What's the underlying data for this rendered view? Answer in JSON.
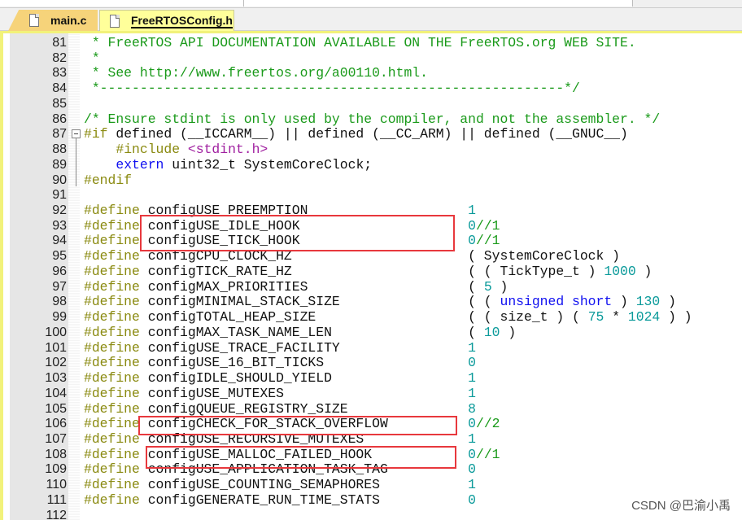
{
  "tabs": [
    {
      "label": "main.c",
      "active": false
    },
    {
      "label": "FreeRTOSConfig.h",
      "active": true
    }
  ],
  "colors": {
    "comment": "#1a9a1a",
    "preprocessor": "#8a8a10",
    "number": "#0a9a9a",
    "keyword": "#1010f0",
    "string": "#a020a0",
    "highlight_box": "#e8383d"
  },
  "lines": [
    {
      "n": "81",
      "seg": [
        [
          "c",
          " * FreeRTOS API DOCUMENTATION AVAILABLE ON THE FreeRTOS.org WEB SITE."
        ]
      ]
    },
    {
      "n": "82",
      "seg": [
        [
          "c",
          " *"
        ]
      ]
    },
    {
      "n": "83",
      "seg": [
        [
          "c",
          " * See http://www.freertos.org/a00110.html."
        ]
      ]
    },
    {
      "n": "84",
      "seg": [
        [
          "c",
          " *----------------------------------------------------------*/"
        ]
      ]
    },
    {
      "n": "85",
      "seg": []
    },
    {
      "n": "86",
      "seg": [
        [
          "c",
          "/* Ensure stdint is only used by the compiler, and not the assembler. */"
        ]
      ]
    },
    {
      "n": "87",
      "seg": [
        [
          "p",
          "#if"
        ],
        [
          "t",
          " defined (__ICCARM__) || defined (__CC_ARM) || defined (__GNUC__)"
        ]
      ]
    },
    {
      "n": "88",
      "seg": [
        [
          "t",
          "    "
        ],
        [
          "p",
          "#include "
        ],
        [
          "s",
          "<stdint.h>"
        ]
      ]
    },
    {
      "n": "89",
      "seg": [
        [
          "t",
          "    "
        ],
        [
          "k",
          "extern"
        ],
        [
          "t",
          " uint32_t SystemCoreClock;"
        ]
      ]
    },
    {
      "n": "90",
      "seg": [
        [
          "p",
          "#endif"
        ]
      ]
    },
    {
      "n": "91",
      "seg": []
    },
    {
      "n": "92",
      "seg": [
        [
          "p",
          "#define"
        ],
        [
          "t",
          " configUSE_PREEMPTION                    "
        ],
        [
          "n",
          "1"
        ]
      ]
    },
    {
      "n": "93",
      "seg": [
        [
          "p",
          "#define"
        ],
        [
          "t",
          " configUSE_IDLE_HOOK                     "
        ],
        [
          "n",
          "0"
        ],
        [
          "c",
          "//1"
        ]
      ]
    },
    {
      "n": "94",
      "seg": [
        [
          "p",
          "#define"
        ],
        [
          "t",
          " configUSE_TICK_HOOK                     "
        ],
        [
          "n",
          "0"
        ],
        [
          "c",
          "//1"
        ]
      ]
    },
    {
      "n": "95",
      "seg": [
        [
          "p",
          "#define"
        ],
        [
          "t",
          " configCPU_CLOCK_HZ                      ( SystemCoreClock )"
        ]
      ]
    },
    {
      "n": "96",
      "seg": [
        [
          "p",
          "#define"
        ],
        [
          "t",
          " configTICK_RATE_HZ                      ( ( TickType_t ) "
        ],
        [
          "n",
          "1000"
        ],
        [
          "t",
          " )"
        ]
      ]
    },
    {
      "n": "97",
      "seg": [
        [
          "p",
          "#define"
        ],
        [
          "t",
          " configMAX_PRIORITIES                    ( "
        ],
        [
          "n",
          "5"
        ],
        [
          "t",
          " )"
        ]
      ]
    },
    {
      "n": "98",
      "seg": [
        [
          "p",
          "#define"
        ],
        [
          "t",
          " configMINIMAL_STACK_SIZE                ( ( "
        ],
        [
          "k",
          "unsigned short"
        ],
        [
          "t",
          " ) "
        ],
        [
          "n",
          "130"
        ],
        [
          "t",
          " )"
        ]
      ]
    },
    {
      "n": "99",
      "seg": [
        [
          "p",
          "#define"
        ],
        [
          "t",
          " configTOTAL_HEAP_SIZE                   ( ( size_t ) ( "
        ],
        [
          "n",
          "75"
        ],
        [
          "t",
          " * "
        ],
        [
          "n",
          "1024"
        ],
        [
          "t",
          " ) )"
        ]
      ]
    },
    {
      "n": "100",
      "seg": [
        [
          "p",
          "#define"
        ],
        [
          "t",
          " configMAX_TASK_NAME_LEN                 ( "
        ],
        [
          "n",
          "10"
        ],
        [
          "t",
          " )"
        ]
      ]
    },
    {
      "n": "101",
      "seg": [
        [
          "p",
          "#define"
        ],
        [
          "t",
          " configUSE_TRACE_FACILITY                "
        ],
        [
          "n",
          "1"
        ]
      ]
    },
    {
      "n": "102",
      "seg": [
        [
          "p",
          "#define"
        ],
        [
          "t",
          " configUSE_16_BIT_TICKS                  "
        ],
        [
          "n",
          "0"
        ]
      ]
    },
    {
      "n": "103",
      "seg": [
        [
          "p",
          "#define"
        ],
        [
          "t",
          " configIDLE_SHOULD_YIELD                 "
        ],
        [
          "n",
          "1"
        ]
      ]
    },
    {
      "n": "104",
      "seg": [
        [
          "p",
          "#define"
        ],
        [
          "t",
          " configUSE_MUTEXES                       "
        ],
        [
          "n",
          "1"
        ]
      ]
    },
    {
      "n": "105",
      "seg": [
        [
          "p",
          "#define"
        ],
        [
          "t",
          " configQUEUE_REGISTRY_SIZE               "
        ],
        [
          "n",
          "8"
        ]
      ]
    },
    {
      "n": "106",
      "seg": [
        [
          "p",
          "#define"
        ],
        [
          "t",
          " configCHECK_FOR_STACK_OVERFLOW          "
        ],
        [
          "n",
          "0"
        ],
        [
          "c",
          "//2"
        ]
      ]
    },
    {
      "n": "107",
      "seg": [
        [
          "p",
          "#define"
        ],
        [
          "t",
          " configUSE_RECURSIVE_MUTEXES             "
        ],
        [
          "n",
          "1"
        ]
      ]
    },
    {
      "n": "108",
      "seg": [
        [
          "p",
          "#define"
        ],
        [
          "t",
          " configUSE_MALLOC_FAILED_HOOK            "
        ],
        [
          "n",
          "0"
        ],
        [
          "c",
          "//1"
        ]
      ]
    },
    {
      "n": "109",
      "seg": [
        [
          "p",
          "#define"
        ],
        [
          "t",
          " configUSE_APPLICATION_TASK_TAG          "
        ],
        [
          "n",
          "0"
        ]
      ]
    },
    {
      "n": "110",
      "seg": [
        [
          "p",
          "#define"
        ],
        [
          "t",
          " configUSE_COUNTING_SEMAPHORES           "
        ],
        [
          "n",
          "1"
        ]
      ]
    },
    {
      "n": "111",
      "seg": [
        [
          "p",
          "#define"
        ],
        [
          "t",
          " configGENERATE_RUN_TIME_STATS           "
        ],
        [
          "n",
          "0"
        ]
      ]
    },
    {
      "n": "112",
      "seg": []
    }
  ],
  "watermark": "CSDN @巴渝小禹"
}
